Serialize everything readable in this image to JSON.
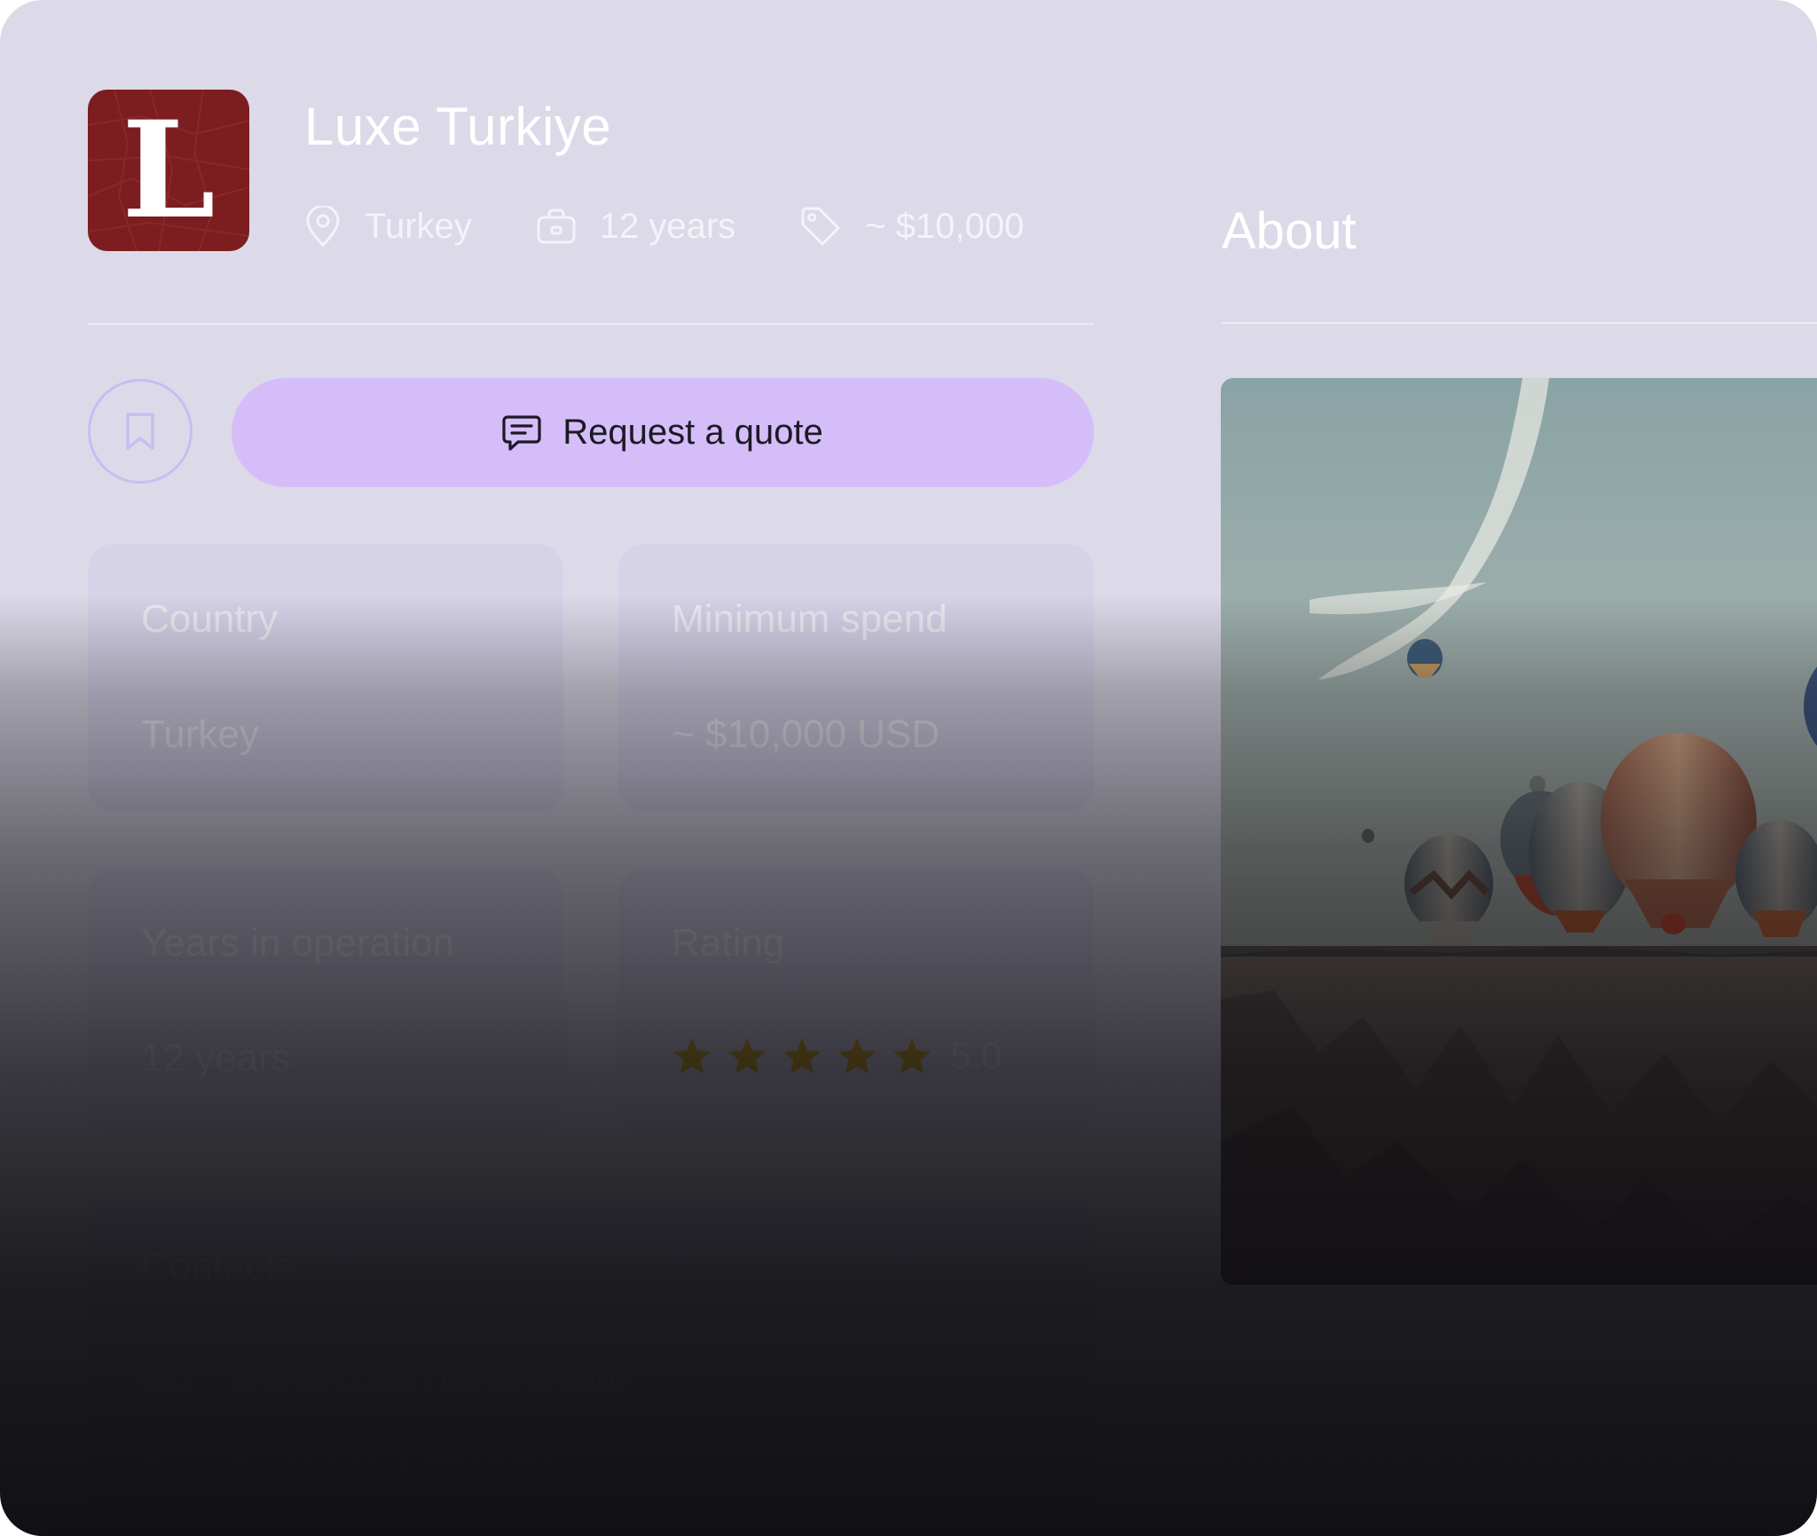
{
  "company": {
    "logo_letter": "L",
    "name": "Luxe Turkiye",
    "meta": {
      "location": "Turkey",
      "experience": "12 years",
      "price": "~ $10,000"
    }
  },
  "actions": {
    "request_quote_label": "Request a quote"
  },
  "about": {
    "heading": "About",
    "lines": [
      "Luxe Turkiye is a privately-own",
      "customized travel experience",
      "strives to understand each of"
    ]
  },
  "stats": {
    "country": {
      "label": "Country",
      "value": "Turkey"
    },
    "minimum_spend": {
      "label": "Minimum spend",
      "value": "~ $10,000 USD"
    },
    "years_in_operation": {
      "label": "Years in operation",
      "value": "12 years"
    },
    "rating": {
      "label": "Rating",
      "value": "5.0",
      "stars": 5,
      "max_stars": 5
    }
  },
  "contacts": {
    "label": "Contacts",
    "email": "info@LuxeTurkiye.com",
    "phone": "+1 (123) 456-7890"
  },
  "colors": {
    "background": "#dcdae8",
    "logo": "#7c1d1f",
    "accent_button": "#d5bdf9",
    "star": "#d4a514"
  },
  "icons": {
    "location": "map-pin-icon",
    "experience": "briefcase-icon",
    "price": "price-tag-icon",
    "bookmark": "bookmark-icon",
    "quote": "chat-icon",
    "email": "mail-icon",
    "phone": "phone-icon",
    "star": "star-icon"
  }
}
